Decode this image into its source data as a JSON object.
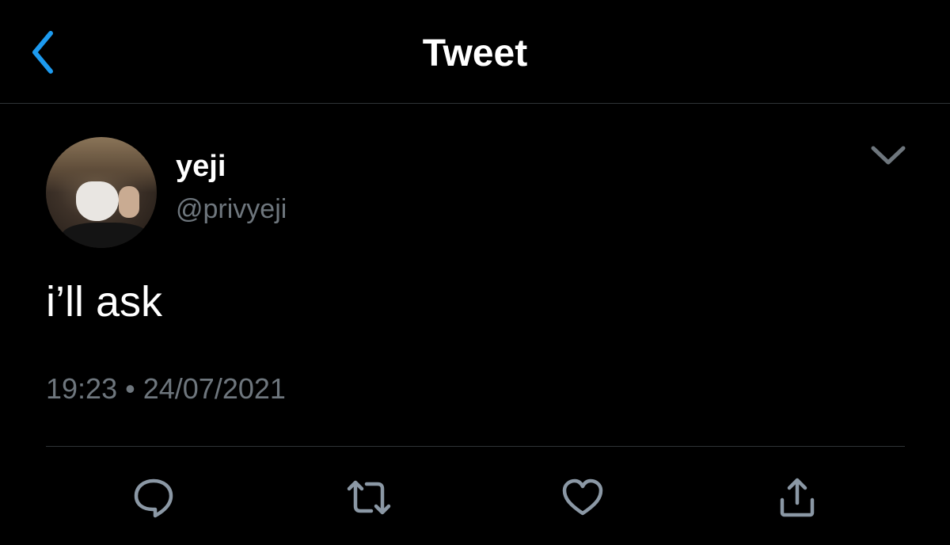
{
  "header": {
    "title": "Tweet",
    "back_icon": "chevron-left-icon",
    "accent_color": "#1d9bf0"
  },
  "tweet": {
    "author": {
      "display_name": "yeji",
      "handle": "@privyeji"
    },
    "text": "i’ll ask",
    "time": "19:23",
    "separator": "•",
    "date": "24/07/2021",
    "menu_icon": "chevron-down-icon"
  },
  "actions": [
    {
      "name": "reply",
      "icon": "speech-bubble-icon"
    },
    {
      "name": "retweet",
      "icon": "retweet-icon"
    },
    {
      "name": "like",
      "icon": "heart-icon"
    },
    {
      "name": "share",
      "icon": "share-icon"
    }
  ],
  "colors": {
    "background": "#000000",
    "primary_text": "#ffffff",
    "secondary_text": "#6e767d",
    "icon_gray": "#8b98a5",
    "divider": "#2f3336"
  }
}
